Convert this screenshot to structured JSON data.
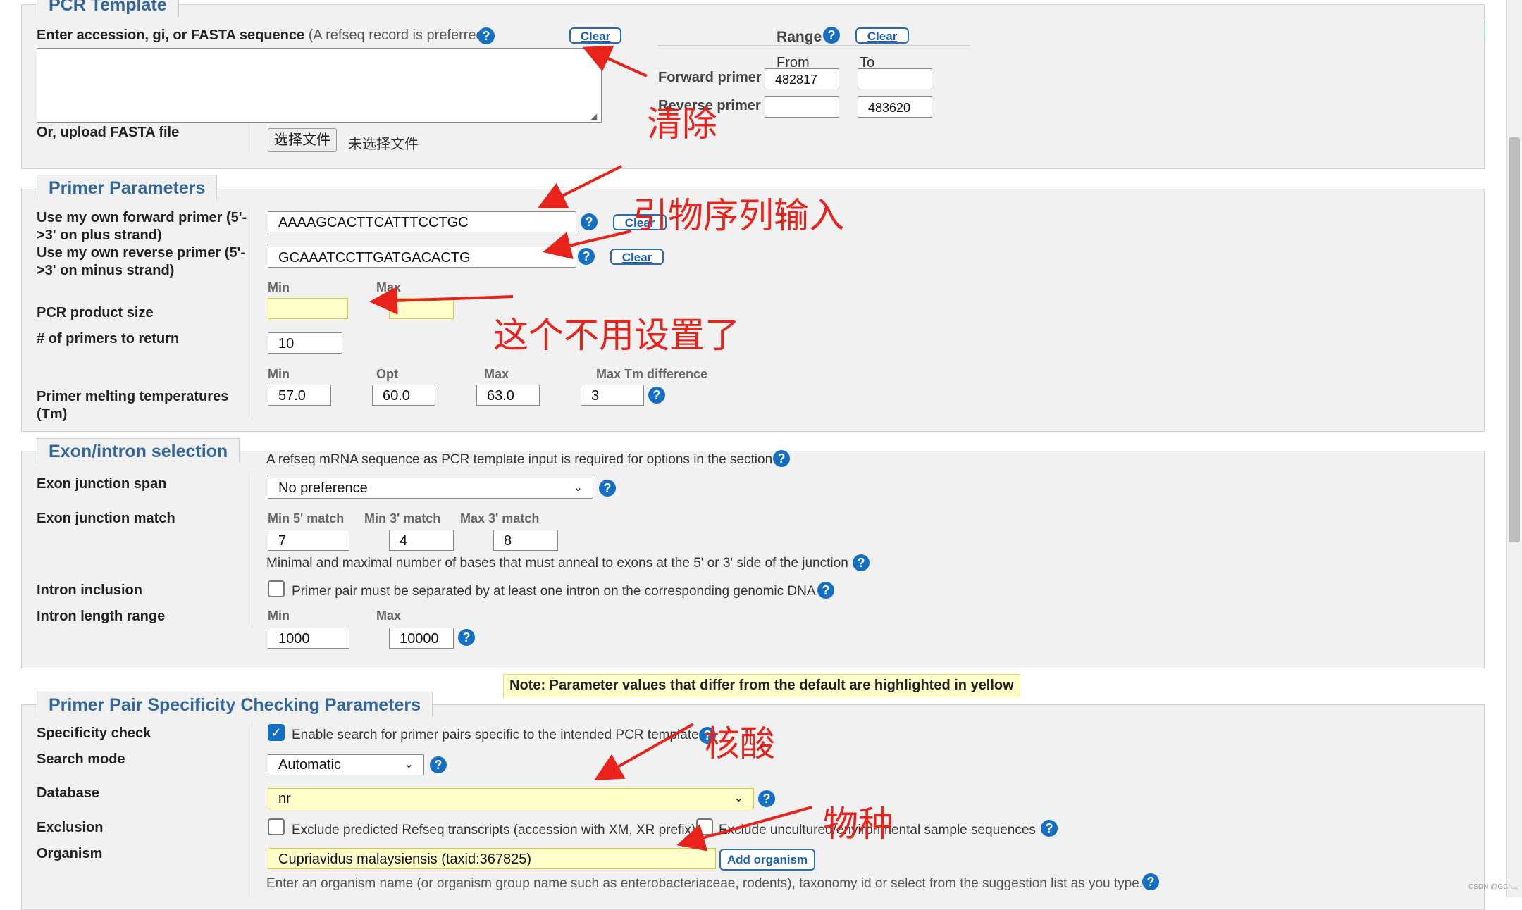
{
  "pcr_template": {
    "legend": "PCR Template",
    "accession_label": "Enter accession, gi, or FASTA sequence",
    "accession_hint": "(A refseq record is preferred)",
    "clear": "Clear",
    "upload_label": "Or, upload FASTA file",
    "choose_file": "选择文件",
    "no_file": "未选择文件",
    "range_label": "Range",
    "range_clear": "Clear",
    "from_label": "From",
    "to_label": "To",
    "forward_primer_label": "Forward primer",
    "forward_from": "482817",
    "forward_to": "",
    "reverse_primer_label": "Reverse primer",
    "reverse_from": "",
    "reverse_to": "483620"
  },
  "primer_params": {
    "legend": "Primer Parameters",
    "forward_label": "Use my own forward primer (5'->3' on plus strand)",
    "forward_value": "AAAAGCACTTCATTTCCTGC",
    "forward_clear": "Clear",
    "reverse_label": "Use my own reverse primer (5'->3' on minus strand)",
    "reverse_value": "GCAAATCCTTGATGACACTG",
    "reverse_clear": "Clear",
    "product_min_label": "Min",
    "product_max_label": "Max",
    "product_size_label": "PCR product size",
    "product_min": "",
    "product_max": "",
    "num_primers_label": "# of primers to return",
    "num_primers": "10",
    "tm_min_label": "Min",
    "tm_opt_label": "Opt",
    "tm_max_label": "Max",
    "tm_diff_label": "Max Tm difference",
    "tm_label": "Primer melting temperatures (Tm)",
    "tm_min": "57.0",
    "tm_opt": "60.0",
    "tm_max": "63.0",
    "tm_diff": "3"
  },
  "exon_intron": {
    "legend": "Exon/intron selection",
    "note": "A refseq mRNA sequence as PCR template input is required for options in the section",
    "junction_span_label": "Exon junction span",
    "junction_span_value": "No preference",
    "junction_match_label": "Exon junction match",
    "min5_label": "Min 5' match",
    "min3_label": "Min 3' match",
    "max3_label": "Max 3' match",
    "min5": "7",
    "min3": "4",
    "max3": "8",
    "match_hint": "Minimal and maximal number of bases that must anneal to exons at the 5' or 3' side of the junction",
    "intron_inclusion_label": "Intron inclusion",
    "intron_inclusion_text": "Primer pair must be separated by at least one intron on the corresponding genomic DNA",
    "intron_length_label": "Intron length range",
    "intron_min_label": "Min",
    "intron_max_label": "Max",
    "intron_min": "1000",
    "intron_max": "10000"
  },
  "note_bar": "Note: Parameter values that differ from the default are highlighted in yellow",
  "specificity": {
    "legend": "Primer Pair Specificity Checking Parameters",
    "check_label": "Specificity check",
    "check_text": "Enable search for primer pairs specific to the intended PCR template",
    "search_mode_label": "Search mode",
    "search_mode_value": "Automatic",
    "database_label": "Database",
    "database_value": "nr",
    "exclusion_label": "Exclusion",
    "exclude_predicted": "Exclude predicted Refseq transcripts (accession with XM, XR prefix)",
    "exclude_uncultured": "Exclude uncultured/environmental sample sequences",
    "organism_label": "Organism",
    "organism_value": "Cupriavidus malaysiensis (taxid:367825)",
    "add_organism": "Add organism",
    "organism_hint": "Enter an organism name (or organism group name such as enterobacteriaceae, rodents), taxonomy id or select from the suggestion list as you type."
  },
  "annotations": {
    "clear_note": "清除",
    "primer_note": "引物序列输入",
    "no_need_note": "这个不用设置了",
    "nucleic_note": "核酸",
    "species_note": "物种"
  },
  "watermark": "CSDN @GCh..."
}
